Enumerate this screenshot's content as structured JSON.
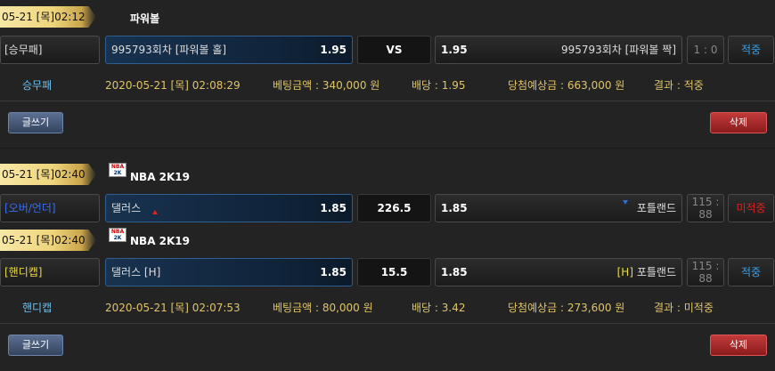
{
  "bet1": {
    "date": "05-21 [목]02:12",
    "title": "파워볼",
    "type_label": "[승무패]",
    "home": "995793회차 [파워볼 홀]",
    "home_odd": "1.95",
    "mid": "VS",
    "away_odd": "1.95",
    "away": "995793회차 [파워볼 짝]",
    "score": "1 : 0",
    "status": "적중",
    "info": {
      "type": "승무패",
      "datetime": "2020-05-21 [목] 02:08:29",
      "amount": "베팅금액 : 340,000 원",
      "odds": "배당 : 1.95",
      "expected": "당첨예상금 : 663,000 원",
      "result": "결과 : 적중"
    },
    "write_label": "글쓰기",
    "delete_label": "삭제"
  },
  "bet2": {
    "g1": {
      "date": "05-21 [목]02:40",
      "title": "NBA 2K19",
      "type_label": "[오버/언더]",
      "home": "댈러스",
      "home_odd": "1.85",
      "mid": "226.5",
      "away_odd": "1.85",
      "away": "포틀랜드",
      "score_top": "115 :",
      "score_bottom": "88",
      "status": "미적중"
    },
    "g2": {
      "date": "05-21 [목]02:40",
      "title": "NBA 2K19",
      "type_label": "[핸디캡]",
      "home": "댈러스 [H]",
      "home_odd": "1.85",
      "mid": "15.5",
      "away_odd": "1.85",
      "away_h": "[H]",
      "away": "포틀랜드",
      "score_top": "115 :",
      "score_bottom": "88",
      "status": "적중"
    },
    "info": {
      "type": "핸디캡",
      "datetime": "2020-05-21 [목] 02:07:53",
      "amount": "베팅금액 : 80,000 원",
      "odds": "배당 : 3.42",
      "expected": "당첨예상금 : 273,600 원",
      "result": "결과 : 미적중"
    },
    "write_label": "글쓰기",
    "delete_label": "삭제"
  }
}
